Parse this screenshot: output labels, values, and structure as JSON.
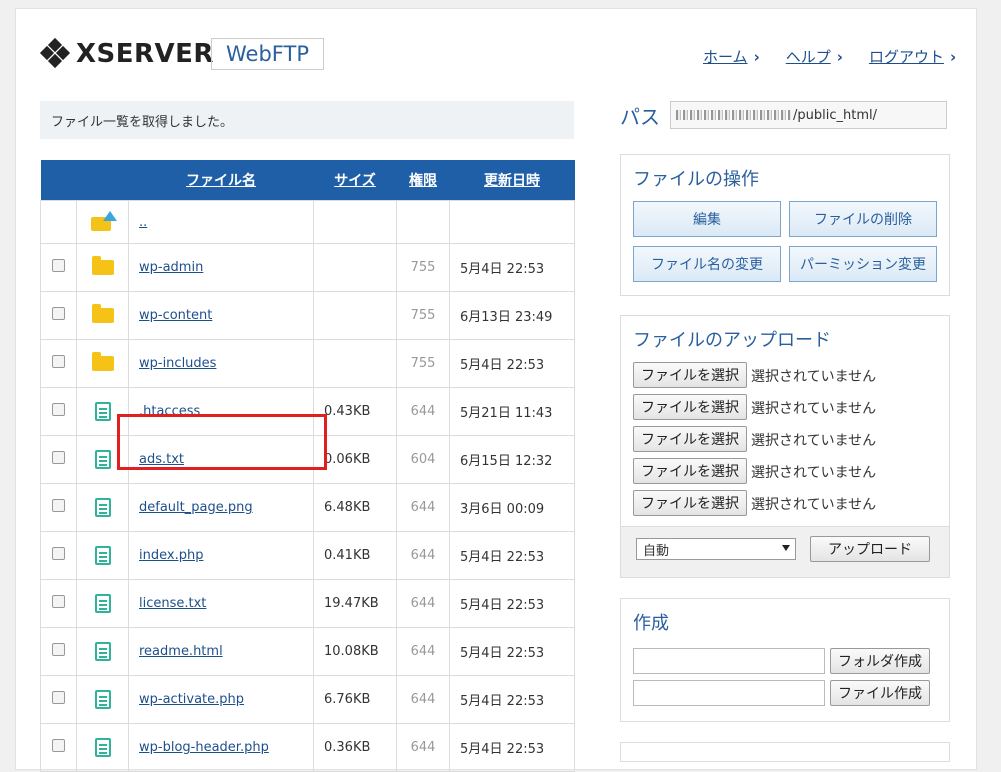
{
  "header": {
    "logo_text": "XSERVER",
    "product": "WebFTP",
    "nav": [
      {
        "label": "ホーム"
      },
      {
        "label": "ヘルプ"
      },
      {
        "label": "ログアウト"
      }
    ]
  },
  "message": "ファイル一覧を取得しました。",
  "table": {
    "headers": {
      "name": "ファイル名",
      "size": "サイズ",
      "perm": "権限",
      "date": "更新日時"
    },
    "parent": {
      "name": ".."
    },
    "rows": [
      {
        "icon": "folder-icon",
        "name": "wp-admin",
        "size": "",
        "perm": "755",
        "date": "5月4日 22:53"
      },
      {
        "icon": "folder-icon",
        "name": "wp-content",
        "size": "",
        "perm": "755",
        "date": "6月13日 23:49"
      },
      {
        "icon": "folder-icon",
        "name": "wp-includes",
        "size": "",
        "perm": "755",
        "date": "5月4日 22:53"
      },
      {
        "icon": "document-icon",
        "name": ".htaccess",
        "size": "0.43KB",
        "perm": "644",
        "date": "5月21日 11:43"
      },
      {
        "icon": "document-icon",
        "name": "ads.txt",
        "size": "0.06KB",
        "perm": "604",
        "date": "6月15日 12:32"
      },
      {
        "icon": "document-icon",
        "name": "default_page.png",
        "size": "6.48KB",
        "perm": "644",
        "date": "3月6日 00:09"
      },
      {
        "icon": "document-icon",
        "name": "index.php",
        "size": "0.41KB",
        "perm": "644",
        "date": "5月4日 22:53"
      },
      {
        "icon": "document-icon",
        "name": "license.txt",
        "size": "19.47KB",
        "perm": "644",
        "date": "5月4日 22:53"
      },
      {
        "icon": "document-icon",
        "name": "readme.html",
        "size": "10.08KB",
        "perm": "644",
        "date": "5月4日 22:53"
      },
      {
        "icon": "document-icon",
        "name": "wp-activate.php",
        "size": "6.76KB",
        "perm": "644",
        "date": "5月4日 22:53"
      },
      {
        "icon": "document-icon",
        "name": "wp-blog-header.php",
        "size": "0.36KB",
        "perm": "644",
        "date": "5月4日 22:53"
      }
    ]
  },
  "path": {
    "label": "パス",
    "value": "/public_html/"
  },
  "file_ops": {
    "title": "ファイルの操作",
    "edit": "編集",
    "delete": "ファイルの削除",
    "rename": "ファイル名の変更",
    "permission": "パーミッション変更"
  },
  "upload": {
    "title": "ファイルのアップロード",
    "choose_label": "ファイルを選択",
    "no_file": "選択されていません",
    "mode_value": "自動",
    "submit": "アップロード"
  },
  "create": {
    "title": "作成",
    "folder_button": "フォルダ作成",
    "file_button": "ファイル作成"
  },
  "colors": {
    "header_blue": "#1f5fa8",
    "link_blue": "#1e4f8c",
    "highlight_red": "#e02020",
    "folder_yellow": "#f5c218",
    "doc_teal": "#2fb39a"
  }
}
